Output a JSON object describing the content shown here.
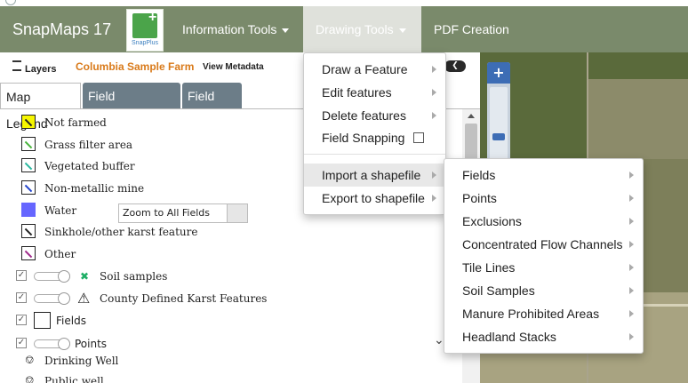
{
  "navbar": {
    "brand": "SnapMaps 17",
    "logo_text": "SnapPlus",
    "menus": [
      {
        "label": "Information Tools"
      },
      {
        "label": "Drawing Tools"
      },
      {
        "label": "PDF Creation"
      }
    ]
  },
  "panel": {
    "layers_label": "Layers",
    "farm_name": "Columbia Sample Farm",
    "view_metadata": "View Metadata",
    "tabs": [
      {
        "label": "Map Legend"
      },
      {
        "label": "Field Properties"
      },
      {
        "label": "Field List"
      }
    ]
  },
  "legend": {
    "items": [
      {
        "label": "Not farmed",
        "color": "#f6f600"
      },
      {
        "label": "Grass filter area",
        "color": "#ffffff"
      },
      {
        "label": "Vegetated buffer",
        "color": "#ffffff"
      },
      {
        "label": "Non-metallic mine",
        "color": "#ffffff"
      },
      {
        "label": "Water",
        "color": "#6666ff"
      },
      {
        "label": "Sinkhole/other karst feature",
        "color": "#ffffff"
      },
      {
        "label": "Other",
        "color": "#ffffff"
      }
    ],
    "soil_samples": "Soil samples",
    "karst": "County Defined Karst Features",
    "fields": "Fields",
    "zoom_select": "Zoom to All Fields",
    "points": "Points",
    "drinking_well": "Drinking Well",
    "public_well": "Public well"
  },
  "drawing_menu": {
    "items": [
      {
        "label": "Draw a Feature"
      },
      {
        "label": "Edit features"
      },
      {
        "label": "Delete features"
      },
      {
        "label": "Field Snapping"
      },
      {
        "label": "Import a shapefile"
      },
      {
        "label": "Export to shapefile"
      }
    ]
  },
  "import_menu": {
    "items": [
      {
        "label": "Fields"
      },
      {
        "label": "Points"
      },
      {
        "label": "Exclusions"
      },
      {
        "label": "Concentrated Flow Channels"
      },
      {
        "label": "Tile Lines"
      },
      {
        "label": "Soil Samples"
      },
      {
        "label": "Manure Prohibited Areas"
      },
      {
        "label": "Headland Stacks"
      }
    ]
  },
  "colors": {
    "navbar": "#7a8a6b",
    "tab_inactive": "#6c7d88",
    "farm_name": "#d97a1a",
    "map_control": "#3d6db5"
  }
}
